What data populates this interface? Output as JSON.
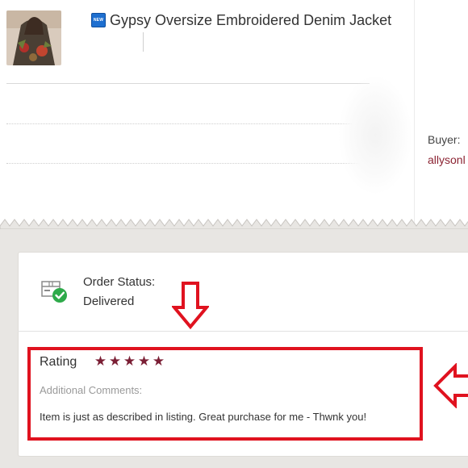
{
  "product": {
    "badge": "NEW",
    "title": "Gypsy Oversize Embroidered Denim Jacket"
  },
  "buyer": {
    "label": "Buyer:",
    "name": "allysonl"
  },
  "order": {
    "status_label": "Order Status:",
    "status_value": "Delivered"
  },
  "review": {
    "rating_label": "Rating",
    "stars": [
      "★",
      "★",
      "★",
      "★",
      "★"
    ],
    "rating_value": 5,
    "comments_label": "Additional Comments:",
    "comment": "Item is just as described in listing. Great purchase for me - Thwnk you!"
  },
  "colors": {
    "accent": "#7b1f35",
    "annotation": "#e0121f",
    "buyer_link": "#8b2332",
    "status_check": "#2eaa4a",
    "section_background": "#e8e6e3"
  },
  "icons": {
    "status": "delivered-box-check-icon",
    "annotation_down": "down-arrow-icon",
    "annotation_left": "left-arrow-icon"
  }
}
